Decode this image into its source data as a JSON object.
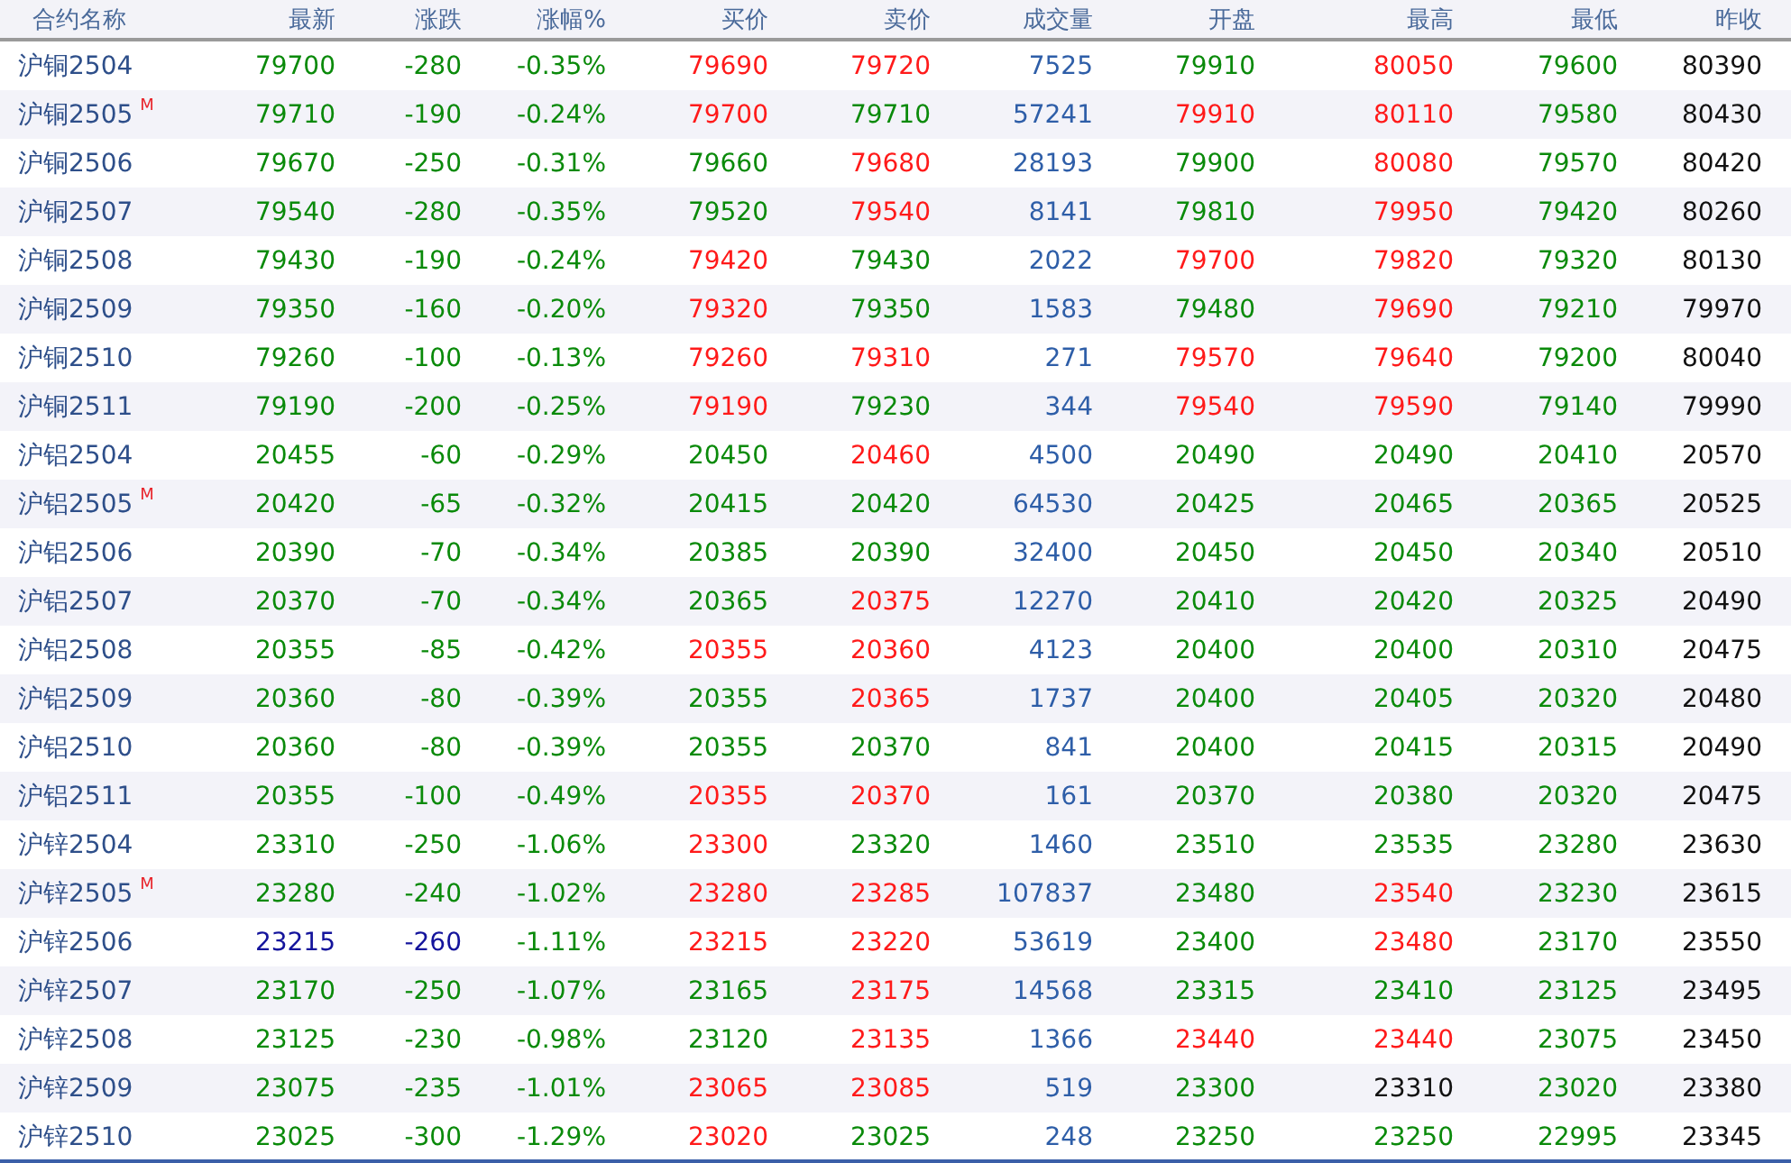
{
  "table": {
    "columns": [
      "合约名称",
      "最新",
      "涨跌",
      "涨幅%",
      "买价",
      "卖价",
      "成交量",
      "开盘",
      "最高",
      "最低",
      "昨收"
    ],
    "rows": [
      {
        "cells": [
          {
            "text": "沪铜2504",
            "color": "#2e4f8a"
          },
          {
            "text": "79700",
            "color": "#0a8a0a"
          },
          {
            "text": "-280",
            "color": "#0a8a0a"
          },
          {
            "text": "-0.35%",
            "color": "#0a8a0a"
          },
          {
            "text": "79690",
            "color": "#ff1a1a"
          },
          {
            "text": "79720",
            "color": "#ff1a1a"
          },
          {
            "text": "7525",
            "color": "#2e5ea8"
          },
          {
            "text": "79910",
            "color": "#0a8a0a"
          },
          {
            "text": "80050",
            "color": "#ff1a1a"
          },
          {
            "text": "79600",
            "color": "#0a8a0a"
          },
          {
            "text": "80390",
            "color": "#111111"
          }
        ]
      },
      {
        "cells": [
          {
            "text": "沪铜2505",
            "color": "#2e4f8a",
            "badge": "M"
          },
          {
            "text": "79710",
            "color": "#0a8a0a"
          },
          {
            "text": "-190",
            "color": "#0a8a0a"
          },
          {
            "text": "-0.24%",
            "color": "#0a8a0a"
          },
          {
            "text": "79700",
            "color": "#ff1a1a"
          },
          {
            "text": "79710",
            "color": "#0a8a0a"
          },
          {
            "text": "57241",
            "color": "#2e5ea8"
          },
          {
            "text": "79910",
            "color": "#ff1a1a"
          },
          {
            "text": "80110",
            "color": "#ff1a1a"
          },
          {
            "text": "79580",
            "color": "#0a8a0a"
          },
          {
            "text": "80430",
            "color": "#111111"
          }
        ]
      },
      {
        "cells": [
          {
            "text": "沪铜2506",
            "color": "#2e4f8a"
          },
          {
            "text": "79670",
            "color": "#0a8a0a"
          },
          {
            "text": "-250",
            "color": "#0a8a0a"
          },
          {
            "text": "-0.31%",
            "color": "#0a8a0a"
          },
          {
            "text": "79660",
            "color": "#0a8a0a"
          },
          {
            "text": "79680",
            "color": "#ff1a1a"
          },
          {
            "text": "28193",
            "color": "#2e5ea8"
          },
          {
            "text": "79900",
            "color": "#0a8a0a"
          },
          {
            "text": "80080",
            "color": "#ff1a1a"
          },
          {
            "text": "79570",
            "color": "#0a8a0a"
          },
          {
            "text": "80420",
            "color": "#111111"
          }
        ]
      },
      {
        "cells": [
          {
            "text": "沪铜2507",
            "color": "#2e4f8a"
          },
          {
            "text": "79540",
            "color": "#0a8a0a"
          },
          {
            "text": "-280",
            "color": "#0a8a0a"
          },
          {
            "text": "-0.35%",
            "color": "#0a8a0a"
          },
          {
            "text": "79520",
            "color": "#0a8a0a"
          },
          {
            "text": "79540",
            "color": "#ff1a1a"
          },
          {
            "text": "8141",
            "color": "#2e5ea8"
          },
          {
            "text": "79810",
            "color": "#0a8a0a"
          },
          {
            "text": "79950",
            "color": "#ff1a1a"
          },
          {
            "text": "79420",
            "color": "#0a8a0a"
          },
          {
            "text": "80260",
            "color": "#111111"
          }
        ]
      },
      {
        "cells": [
          {
            "text": "沪铜2508",
            "color": "#2e4f8a"
          },
          {
            "text": "79430",
            "color": "#0a8a0a"
          },
          {
            "text": "-190",
            "color": "#0a8a0a"
          },
          {
            "text": "-0.24%",
            "color": "#0a8a0a"
          },
          {
            "text": "79420",
            "color": "#ff1a1a"
          },
          {
            "text": "79430",
            "color": "#0a8a0a"
          },
          {
            "text": "2022",
            "color": "#2e5ea8"
          },
          {
            "text": "79700",
            "color": "#ff1a1a"
          },
          {
            "text": "79820",
            "color": "#ff1a1a"
          },
          {
            "text": "79320",
            "color": "#0a8a0a"
          },
          {
            "text": "80130",
            "color": "#111111"
          }
        ]
      },
      {
        "cells": [
          {
            "text": "沪铜2509",
            "color": "#2e4f8a"
          },
          {
            "text": "79350",
            "color": "#0a8a0a"
          },
          {
            "text": "-160",
            "color": "#0a8a0a"
          },
          {
            "text": "-0.20%",
            "color": "#0a8a0a"
          },
          {
            "text": "79320",
            "color": "#ff1a1a"
          },
          {
            "text": "79350",
            "color": "#0a8a0a"
          },
          {
            "text": "1583",
            "color": "#2e5ea8"
          },
          {
            "text": "79480",
            "color": "#0a8a0a"
          },
          {
            "text": "79690",
            "color": "#ff1a1a"
          },
          {
            "text": "79210",
            "color": "#0a8a0a"
          },
          {
            "text": "79970",
            "color": "#111111"
          }
        ]
      },
      {
        "cells": [
          {
            "text": "沪铜2510",
            "color": "#2e4f8a"
          },
          {
            "text": "79260",
            "color": "#0a8a0a"
          },
          {
            "text": "-100",
            "color": "#0a8a0a"
          },
          {
            "text": "-0.13%",
            "color": "#0a8a0a"
          },
          {
            "text": "79260",
            "color": "#ff1a1a"
          },
          {
            "text": "79310",
            "color": "#ff1a1a"
          },
          {
            "text": "271",
            "color": "#2e5ea8"
          },
          {
            "text": "79570",
            "color": "#ff1a1a"
          },
          {
            "text": "79640",
            "color": "#ff1a1a"
          },
          {
            "text": "79200",
            "color": "#0a8a0a"
          },
          {
            "text": "80040",
            "color": "#111111"
          }
        ]
      },
      {
        "cells": [
          {
            "text": "沪铜2511",
            "color": "#2e4f8a"
          },
          {
            "text": "79190",
            "color": "#0a8a0a"
          },
          {
            "text": "-200",
            "color": "#0a8a0a"
          },
          {
            "text": "-0.25%",
            "color": "#0a8a0a"
          },
          {
            "text": "79190",
            "color": "#ff1a1a"
          },
          {
            "text": "79230",
            "color": "#0a8a0a"
          },
          {
            "text": "344",
            "color": "#2e5ea8"
          },
          {
            "text": "79540",
            "color": "#ff1a1a"
          },
          {
            "text": "79590",
            "color": "#ff1a1a"
          },
          {
            "text": "79140",
            "color": "#0a8a0a"
          },
          {
            "text": "79990",
            "color": "#111111"
          }
        ]
      },
      {
        "cells": [
          {
            "text": "沪铝2504",
            "color": "#2e4f8a"
          },
          {
            "text": "20455",
            "color": "#0a8a0a"
          },
          {
            "text": "-60",
            "color": "#0a8a0a"
          },
          {
            "text": "-0.29%",
            "color": "#0a8a0a"
          },
          {
            "text": "20450",
            "color": "#0a8a0a"
          },
          {
            "text": "20460",
            "color": "#ff1a1a"
          },
          {
            "text": "4500",
            "color": "#2e5ea8"
          },
          {
            "text": "20490",
            "color": "#0a8a0a"
          },
          {
            "text": "20490",
            "color": "#0a8a0a"
          },
          {
            "text": "20410",
            "color": "#0a8a0a"
          },
          {
            "text": "20570",
            "color": "#111111"
          }
        ]
      },
      {
        "cells": [
          {
            "text": "沪铝2505",
            "color": "#2e4f8a",
            "badge": "M"
          },
          {
            "text": "20420",
            "color": "#0a8a0a"
          },
          {
            "text": "-65",
            "color": "#0a8a0a"
          },
          {
            "text": "-0.32%",
            "color": "#0a8a0a"
          },
          {
            "text": "20415",
            "color": "#0a8a0a"
          },
          {
            "text": "20420",
            "color": "#0a8a0a"
          },
          {
            "text": "64530",
            "color": "#2e5ea8"
          },
          {
            "text": "20425",
            "color": "#0a8a0a"
          },
          {
            "text": "20465",
            "color": "#0a8a0a"
          },
          {
            "text": "20365",
            "color": "#0a8a0a"
          },
          {
            "text": "20525",
            "color": "#111111"
          }
        ]
      },
      {
        "cells": [
          {
            "text": "沪铝2506",
            "color": "#2e4f8a"
          },
          {
            "text": "20390",
            "color": "#0a8a0a"
          },
          {
            "text": "-70",
            "color": "#0a8a0a"
          },
          {
            "text": "-0.34%",
            "color": "#0a8a0a"
          },
          {
            "text": "20385",
            "color": "#0a8a0a"
          },
          {
            "text": "20390",
            "color": "#0a8a0a"
          },
          {
            "text": "32400",
            "color": "#2e5ea8"
          },
          {
            "text": "20450",
            "color": "#0a8a0a"
          },
          {
            "text": "20450",
            "color": "#0a8a0a"
          },
          {
            "text": "20340",
            "color": "#0a8a0a"
          },
          {
            "text": "20510",
            "color": "#111111"
          }
        ]
      },
      {
        "cells": [
          {
            "text": "沪铝2507",
            "color": "#2e4f8a"
          },
          {
            "text": "20370",
            "color": "#0a8a0a"
          },
          {
            "text": "-70",
            "color": "#0a8a0a"
          },
          {
            "text": "-0.34%",
            "color": "#0a8a0a"
          },
          {
            "text": "20365",
            "color": "#0a8a0a"
          },
          {
            "text": "20375",
            "color": "#ff1a1a"
          },
          {
            "text": "12270",
            "color": "#2e5ea8"
          },
          {
            "text": "20410",
            "color": "#0a8a0a"
          },
          {
            "text": "20420",
            "color": "#0a8a0a"
          },
          {
            "text": "20325",
            "color": "#0a8a0a"
          },
          {
            "text": "20490",
            "color": "#111111"
          }
        ]
      },
      {
        "cells": [
          {
            "text": "沪铝2508",
            "color": "#2e4f8a"
          },
          {
            "text": "20355",
            "color": "#0a8a0a"
          },
          {
            "text": "-85",
            "color": "#0a8a0a"
          },
          {
            "text": "-0.42%",
            "color": "#0a8a0a"
          },
          {
            "text": "20355",
            "color": "#ff1a1a"
          },
          {
            "text": "20360",
            "color": "#ff1a1a"
          },
          {
            "text": "4123",
            "color": "#2e5ea8"
          },
          {
            "text": "20400",
            "color": "#0a8a0a"
          },
          {
            "text": "20400",
            "color": "#0a8a0a"
          },
          {
            "text": "20310",
            "color": "#0a8a0a"
          },
          {
            "text": "20475",
            "color": "#111111"
          }
        ]
      },
      {
        "cells": [
          {
            "text": "沪铝2509",
            "color": "#2e4f8a"
          },
          {
            "text": "20360",
            "color": "#0a8a0a"
          },
          {
            "text": "-80",
            "color": "#0a8a0a"
          },
          {
            "text": "-0.39%",
            "color": "#0a8a0a"
          },
          {
            "text": "20355",
            "color": "#0a8a0a"
          },
          {
            "text": "20365",
            "color": "#ff1a1a"
          },
          {
            "text": "1737",
            "color": "#2e5ea8"
          },
          {
            "text": "20400",
            "color": "#0a8a0a"
          },
          {
            "text": "20405",
            "color": "#0a8a0a"
          },
          {
            "text": "20320",
            "color": "#0a8a0a"
          },
          {
            "text": "20480",
            "color": "#111111"
          }
        ]
      },
      {
        "cells": [
          {
            "text": "沪铝2510",
            "color": "#2e4f8a"
          },
          {
            "text": "20360",
            "color": "#0a8a0a"
          },
          {
            "text": "-80",
            "color": "#0a8a0a"
          },
          {
            "text": "-0.39%",
            "color": "#0a8a0a"
          },
          {
            "text": "20355",
            "color": "#0a8a0a"
          },
          {
            "text": "20370",
            "color": "#0a8a0a"
          },
          {
            "text": "841",
            "color": "#2e5ea8"
          },
          {
            "text": "20400",
            "color": "#0a8a0a"
          },
          {
            "text": "20415",
            "color": "#0a8a0a"
          },
          {
            "text": "20315",
            "color": "#0a8a0a"
          },
          {
            "text": "20490",
            "color": "#111111"
          }
        ]
      },
      {
        "cells": [
          {
            "text": "沪铝2511",
            "color": "#2e4f8a"
          },
          {
            "text": "20355",
            "color": "#0a8a0a"
          },
          {
            "text": "-100",
            "color": "#0a8a0a"
          },
          {
            "text": "-0.49%",
            "color": "#0a8a0a"
          },
          {
            "text": "20355",
            "color": "#ff1a1a"
          },
          {
            "text": "20370",
            "color": "#ff1a1a"
          },
          {
            "text": "161",
            "color": "#2e5ea8"
          },
          {
            "text": "20370",
            "color": "#0a8a0a"
          },
          {
            "text": "20380",
            "color": "#0a8a0a"
          },
          {
            "text": "20320",
            "color": "#0a8a0a"
          },
          {
            "text": "20475",
            "color": "#111111"
          }
        ]
      },
      {
        "cells": [
          {
            "text": "沪锌2504",
            "color": "#2e4f8a"
          },
          {
            "text": "23310",
            "color": "#0a8a0a"
          },
          {
            "text": "-250",
            "color": "#0a8a0a"
          },
          {
            "text": "-1.06%",
            "color": "#0a8a0a"
          },
          {
            "text": "23300",
            "color": "#ff1a1a"
          },
          {
            "text": "23320",
            "color": "#0a8a0a"
          },
          {
            "text": "1460",
            "color": "#2e5ea8"
          },
          {
            "text": "23510",
            "color": "#0a8a0a"
          },
          {
            "text": "23535",
            "color": "#0a8a0a"
          },
          {
            "text": "23280",
            "color": "#0a8a0a"
          },
          {
            "text": "23630",
            "color": "#111111"
          }
        ]
      },
      {
        "cells": [
          {
            "text": "沪锌2505",
            "color": "#2e4f8a",
            "badge": "M"
          },
          {
            "text": "23280",
            "color": "#0a8a0a"
          },
          {
            "text": "-240",
            "color": "#0a8a0a"
          },
          {
            "text": "-1.02%",
            "color": "#0a8a0a"
          },
          {
            "text": "23280",
            "color": "#ff1a1a"
          },
          {
            "text": "23285",
            "color": "#ff1a1a"
          },
          {
            "text": "107837",
            "color": "#2e5ea8"
          },
          {
            "text": "23480",
            "color": "#0a8a0a"
          },
          {
            "text": "23540",
            "color": "#ff1a1a"
          },
          {
            "text": "23230",
            "color": "#0a8a0a"
          },
          {
            "text": "23615",
            "color": "#111111"
          }
        ]
      },
      {
        "cells": [
          {
            "text": "沪锌2506",
            "color": "#2e4f8a"
          },
          {
            "text": "23215",
            "color": "#14149c"
          },
          {
            "text": "-260",
            "color": "#14149c"
          },
          {
            "text": "-1.11%",
            "color": "#0a8a0a"
          },
          {
            "text": "23215",
            "color": "#ff1a1a"
          },
          {
            "text": "23220",
            "color": "#ff1a1a"
          },
          {
            "text": "53619",
            "color": "#2e5ea8"
          },
          {
            "text": "23400",
            "color": "#0a8a0a"
          },
          {
            "text": "23480",
            "color": "#ff1a1a"
          },
          {
            "text": "23170",
            "color": "#0a8a0a"
          },
          {
            "text": "23550",
            "color": "#111111"
          }
        ]
      },
      {
        "cells": [
          {
            "text": "沪锌2507",
            "color": "#2e4f8a"
          },
          {
            "text": "23170",
            "color": "#0a8a0a"
          },
          {
            "text": "-250",
            "color": "#0a8a0a"
          },
          {
            "text": "-1.07%",
            "color": "#0a8a0a"
          },
          {
            "text": "23165",
            "color": "#0a8a0a"
          },
          {
            "text": "23175",
            "color": "#ff1a1a"
          },
          {
            "text": "14568",
            "color": "#2e5ea8"
          },
          {
            "text": "23315",
            "color": "#0a8a0a"
          },
          {
            "text": "23410",
            "color": "#0a8a0a"
          },
          {
            "text": "23125",
            "color": "#0a8a0a"
          },
          {
            "text": "23495",
            "color": "#111111"
          }
        ]
      },
      {
        "cells": [
          {
            "text": "沪锌2508",
            "color": "#2e4f8a"
          },
          {
            "text": "23125",
            "color": "#0a8a0a"
          },
          {
            "text": "-230",
            "color": "#0a8a0a"
          },
          {
            "text": "-0.98%",
            "color": "#0a8a0a"
          },
          {
            "text": "23120",
            "color": "#0a8a0a"
          },
          {
            "text": "23135",
            "color": "#ff1a1a"
          },
          {
            "text": "1366",
            "color": "#2e5ea8"
          },
          {
            "text": "23440",
            "color": "#ff1a1a"
          },
          {
            "text": "23440",
            "color": "#ff1a1a"
          },
          {
            "text": "23075",
            "color": "#0a8a0a"
          },
          {
            "text": "23450",
            "color": "#111111"
          }
        ]
      },
      {
        "cells": [
          {
            "text": "沪锌2509",
            "color": "#2e4f8a"
          },
          {
            "text": "23075",
            "color": "#0a8a0a"
          },
          {
            "text": "-235",
            "color": "#0a8a0a"
          },
          {
            "text": "-1.01%",
            "color": "#0a8a0a"
          },
          {
            "text": "23065",
            "color": "#ff1a1a"
          },
          {
            "text": "23085",
            "color": "#ff1a1a"
          },
          {
            "text": "519",
            "color": "#2e5ea8"
          },
          {
            "text": "23300",
            "color": "#0a8a0a"
          },
          {
            "text": "23310",
            "color": "#111111"
          },
          {
            "text": "23020",
            "color": "#0a8a0a"
          },
          {
            "text": "23380",
            "color": "#111111"
          }
        ]
      },
      {
        "cells": [
          {
            "text": "沪锌2510",
            "color": "#2e4f8a"
          },
          {
            "text": "23025",
            "color": "#0a8a0a"
          },
          {
            "text": "-300",
            "color": "#0a8a0a"
          },
          {
            "text": "-1.29%",
            "color": "#0a8a0a"
          },
          {
            "text": "23020",
            "color": "#ff1a1a"
          },
          {
            "text": "23025",
            "color": "#0a8a0a"
          },
          {
            "text": "248",
            "color": "#2e5ea8"
          },
          {
            "text": "23250",
            "color": "#0a8a0a"
          },
          {
            "text": "23250",
            "color": "#0a8a0a"
          },
          {
            "text": "22995",
            "color": "#0a8a0a"
          },
          {
            "text": "23345",
            "color": "#111111"
          }
        ]
      }
    ]
  }
}
